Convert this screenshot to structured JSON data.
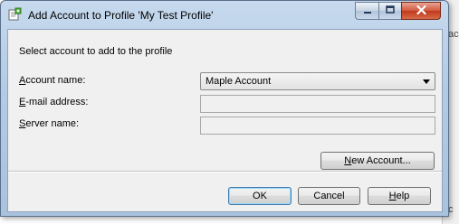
{
  "window": {
    "title": "Add Account to Profile 'My Test Profile'",
    "minimize_icon": "minimize-icon",
    "maximize_icon": "maximize-icon",
    "close_icon": "close-icon"
  },
  "background_window": {
    "fragments": [
      "ac",
      "c"
    ]
  },
  "form": {
    "instruction": "Select account to add to the profile",
    "account_name": {
      "label_underlined": "A",
      "label_rest": "ccount name:",
      "value": "Maple Account"
    },
    "email_address": {
      "label_underlined": "E",
      "label_rest": "-mail address:",
      "value": ""
    },
    "server_name": {
      "label_underlined": "S",
      "label_rest": "erver name:",
      "value": ""
    },
    "new_account_button": {
      "label_underlined": "N",
      "label_rest": "ew Account..."
    }
  },
  "buttons": {
    "ok": "OK",
    "cancel": "Cancel",
    "help_underlined": "H",
    "help_rest": "elp"
  },
  "colors": {
    "title_glass": "#b4cbe4",
    "close_button": "#c0391c",
    "client_background": "#f0f0f0",
    "ok_focus": "#3c7fb1"
  }
}
